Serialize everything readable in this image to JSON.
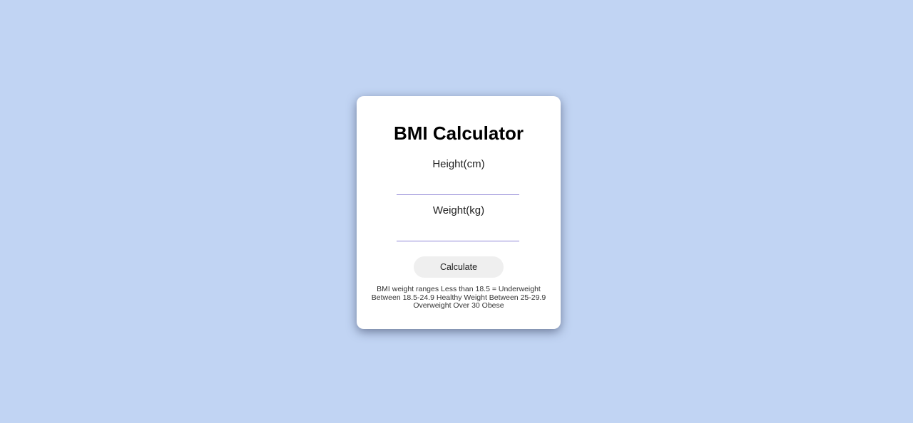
{
  "title": "BMI Calculator",
  "height": {
    "label": "Height(cm)",
    "value": ""
  },
  "weight": {
    "label": "Weight(kg)",
    "value": ""
  },
  "calculate_label": "Calculate",
  "ranges_note": "BMI weight ranges Less than 18.5 = Underweight Between 18.5-24.9 Healthy Weight Between 25-29.9 Overweight Over 30 Obese",
  "colors": {
    "background": "#c1d4f3",
    "input_underline": "#8f86d6",
    "button": "#efefef"
  }
}
